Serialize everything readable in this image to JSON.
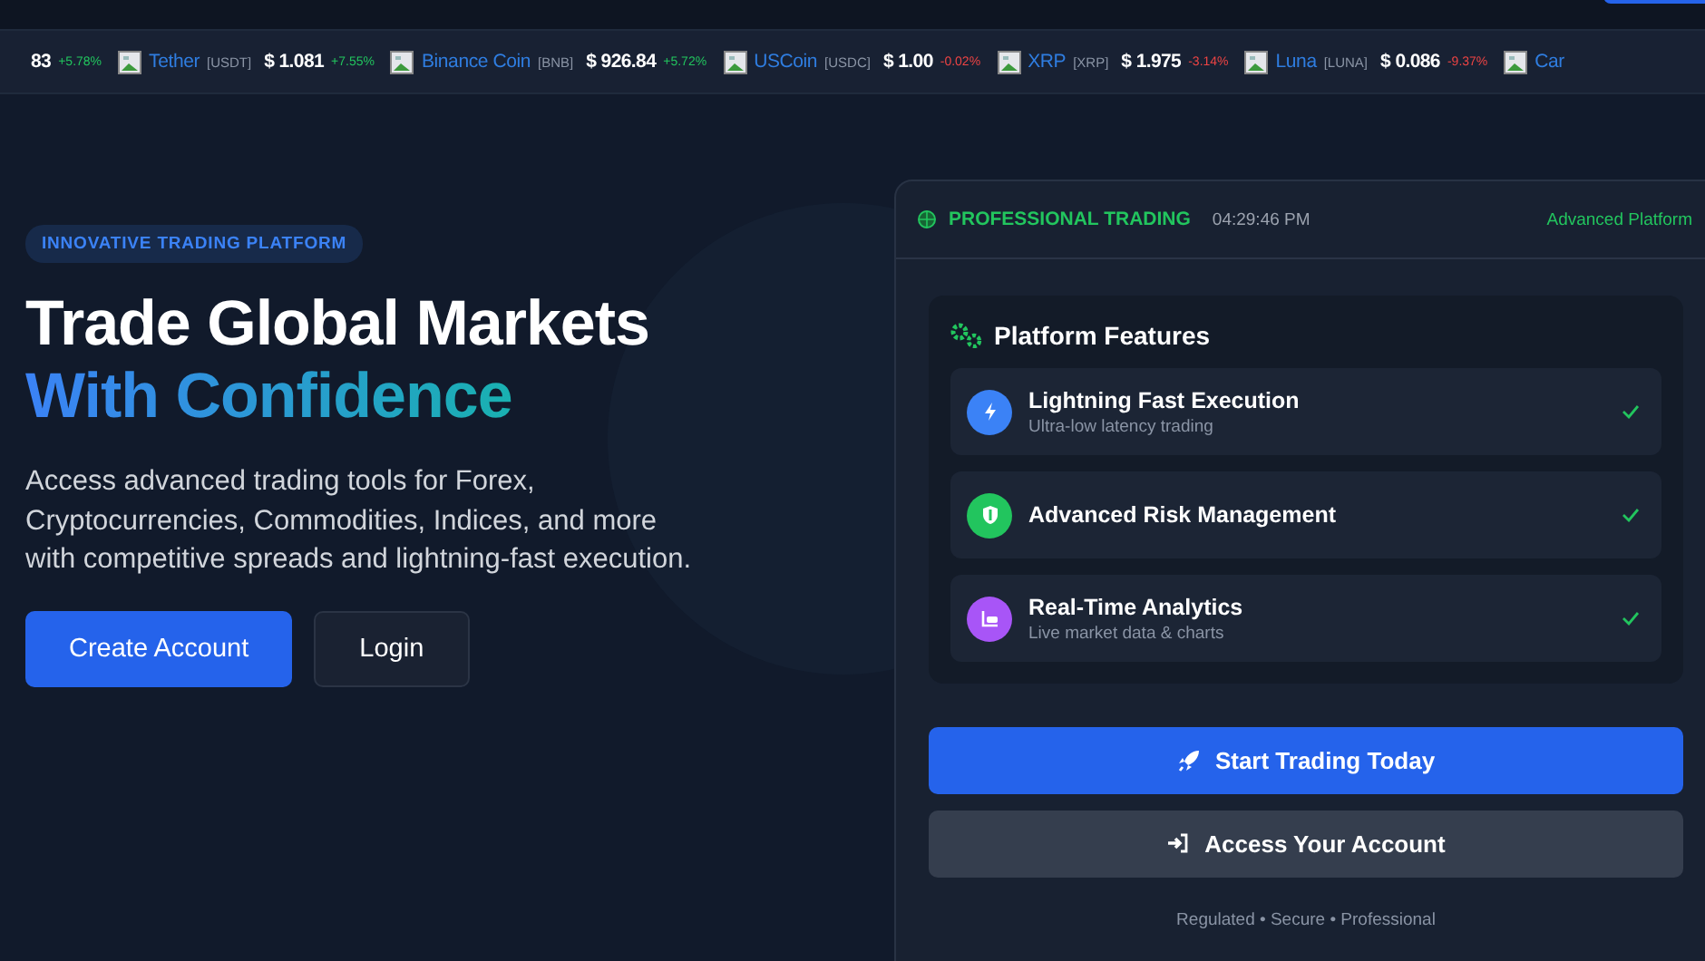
{
  "ticker": [
    {
      "kind": "partial",
      "price": "83",
      "change": "+5.78%",
      "color": "#22c55e"
    },
    {
      "kind": "coin",
      "name": "Tether",
      "symbol": "[USDT]",
      "price": "$ 1.081",
      "change": "+7.55%",
      "color": "#22c55e"
    },
    {
      "kind": "coin",
      "name": "Binance Coin",
      "symbol": "[BNB]",
      "price": "$ 926.84",
      "change": "+5.72%",
      "color": "#22c55e"
    },
    {
      "kind": "coin",
      "name": "USCoin",
      "symbol": "[USDC]",
      "price": "$ 1.00",
      "change": "-0.02%",
      "color": "#ef4444"
    },
    {
      "kind": "coin",
      "name": "XRP",
      "symbol": "[XRP]",
      "price": "$ 1.975",
      "change": "-3.14%",
      "color": "#ef4444"
    },
    {
      "kind": "coin",
      "name": "Luna",
      "symbol": "[LUNA]",
      "price": "$ 0.086",
      "change": "-9.37%",
      "color": "#ef4444"
    },
    {
      "kind": "coin",
      "name": "Car"
    }
  ],
  "hero": {
    "badge": "INNOVATIVE TRADING PLATFORM",
    "title_line_1": "Trade Global Markets",
    "title_line_2": "With Confidence",
    "description": "Access advanced trading tools for Forex, Cryptocurrencies, Commodities, Indices, and more with competitive spreads and lightning-fast execution.",
    "buttons": [
      {
        "label": "Create Account",
        "kind": "primary"
      },
      {
        "label": "Login",
        "kind": "secondary"
      }
    ]
  },
  "panel": {
    "status": "PROFESSIONAL TRADING",
    "time": "04:29:46 PM",
    "tag": "Advanced Platform",
    "features_title": "Platform Features",
    "features": [
      {
        "kind": "bolt",
        "title": "Lightning Fast Execution",
        "subtitle": "Ultra-low latency trading",
        "color": "#3b82f6",
        "checked": true
      },
      {
        "kind": "shield",
        "title": "Advanced Risk Management",
        "color": "#22c55e",
        "checked": true
      },
      {
        "kind": "chart",
        "title": "Real-Time Analytics",
        "subtitle": "Live market data & charts",
        "color": "#a855f7",
        "checked": true
      }
    ],
    "buttons": [
      {
        "label": "Start Trading Today",
        "kind": "primary"
      },
      {
        "label": "Access Your Account",
        "kind": "secondary"
      }
    ],
    "footer": "Regulated • Secure • Professional"
  }
}
